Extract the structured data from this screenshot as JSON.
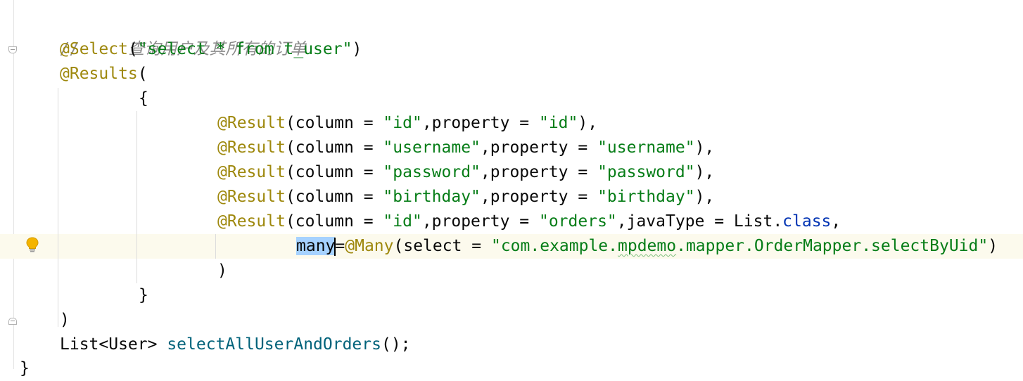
{
  "editor": {
    "comment": "//     查询用户及其所有的订单",
    "select_annotation": "@Select",
    "select_args_open": "(",
    "select_query": "\"select * from t_user\"",
    "select_args_close": ")",
    "results_annotation": "@Results",
    "results_open": "(",
    "brace_open": "{",
    "result_annotation": "@Result",
    "results": [
      {
        "column": "\"id\"",
        "property": "\"id\"",
        "tail": "),"
      },
      {
        "column": "\"username\"",
        "property": "\"username\"",
        "tail": "),"
      },
      {
        "column": "\"password\"",
        "property": "\"password\"",
        "tail": "),"
      },
      {
        "column": "\"birthday\"",
        "property": "\"birthday\"",
        "tail": "),"
      }
    ],
    "last_result": {
      "column": "\"id\"",
      "property": "\"orders\"",
      "java_type_prefix": ",javaType = List.",
      "class_keyword": "class",
      "trailing": ","
    },
    "many_keyword": "many",
    "many_equals": "=",
    "many_annotation": "@Many",
    "many_select_prefix": "(select = ",
    "many_select_pkg_a": "\"com.example.",
    "many_select_pkg_b": "mpdemo",
    "many_select_pkg_c": ".mapper.OrderMapper.selectByUid\"",
    "many_close": ")",
    "inner_close": ")",
    "brace_close": "}",
    "results_close": ")",
    "method_return": "List<User> ",
    "method_name": "selectAllUserAndOrders",
    "method_tail": "();",
    "class_close": "}",
    "column_prefix": "(column = ",
    "property_prefix": ",property = "
  },
  "icons": {
    "intention": "lightbulb-icon",
    "fold_start": "fold-start-icon",
    "fold_end": "fold-end-icon"
  },
  "colors": {
    "annotation": "#9e880d",
    "string": "#067d17",
    "keyword": "#0033b3",
    "comment": "#8c8c8c",
    "method": "#00627a",
    "selection": "#a6d2ff",
    "caret_row": "#fcfaed"
  }
}
